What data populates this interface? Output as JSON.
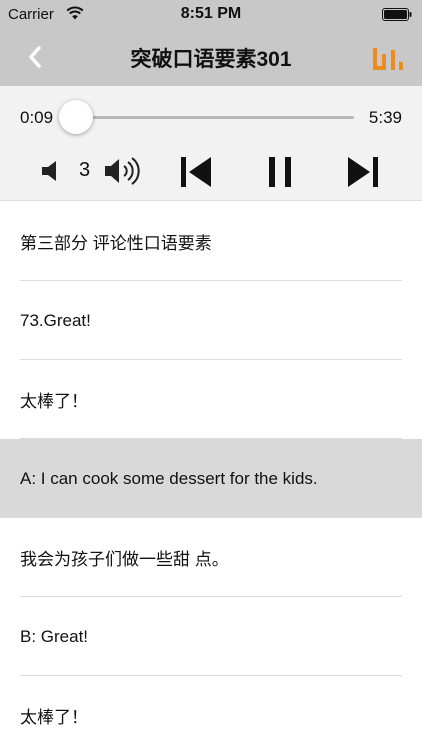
{
  "status_bar": {
    "carrier": "Carrier",
    "time": "8:51 PM"
  },
  "nav": {
    "title": "突破口语要素301",
    "accent_color": "#f08a1c"
  },
  "player": {
    "current_time": "0:09",
    "total_time": "5:39",
    "progress_fraction": 0.027,
    "volume_level": "3",
    "progress_color": "#1e90ff"
  },
  "list": {
    "items": [
      {
        "text": "第三部分 评论性口语要素",
        "highlighted": false
      },
      {
        "text": "73.Great!",
        "highlighted": false
      },
      {
        "text": "太棒了！",
        "highlighted": false
      },
      {
        "text": "A: I can cook some dessert for the kids.",
        "highlighted": true
      },
      {
        "text": "我会为孩子们做一些甜 点。",
        "highlighted": false
      },
      {
        "text": "B: Great!",
        "highlighted": false
      },
      {
        "text": "太棒了！",
        "highlighted": false
      }
    ]
  },
  "icons": {
    "wifi": "wifi-icon",
    "battery": "battery-icon",
    "back": "chevron-left-icon",
    "level": "level-bars-icon",
    "volume_down": "speaker-icon",
    "volume_up": "speaker-loud-icon",
    "previous": "skip-back-icon",
    "pause": "pause-icon",
    "next": "skip-forward-icon"
  }
}
